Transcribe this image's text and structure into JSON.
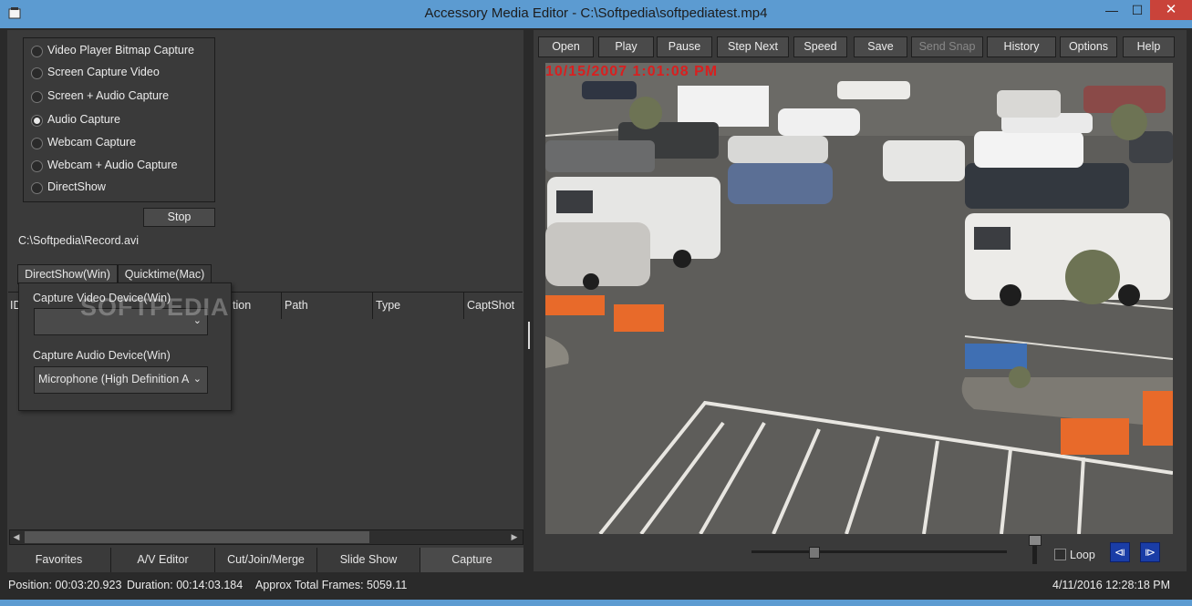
{
  "window": {
    "title": "Accessory Media Editor - C:\\Softpedia\\softpediatest.mp4",
    "min_glyph": "—",
    "max_glyph": "☐",
    "close_glyph": "✕"
  },
  "capture_modes": {
    "items": [
      {
        "label": "Video Player Bitmap Capture",
        "selected": false
      },
      {
        "label": "Screen Capture Video",
        "selected": false
      },
      {
        "label": "Screen + Audio Capture",
        "selected": false
      },
      {
        "label": "Audio Capture",
        "selected": true
      },
      {
        "label": "Webcam Capture",
        "selected": false
      },
      {
        "label": "Webcam + Audio Capture",
        "selected": false
      },
      {
        "label": "DirectShow",
        "selected": false
      }
    ]
  },
  "stop_label": "Stop",
  "output_path": "C:\\Softpedia\\Record.avi",
  "capture_tabs": {
    "directshow": "DirectShow(Win)",
    "quicktime": "Quicktime(Mac)"
  },
  "device_popup": {
    "video_label": "Capture Video Device(Win)",
    "video_value": "",
    "audio_label": "Capture Audio Device(Win)",
    "audio_value": "Microphone (High Definition A"
  },
  "grid": {
    "columns": [
      "ID",
      "tion",
      "Path",
      "Type",
      "CaptShot"
    ]
  },
  "watermark": "SOFTPEDIA",
  "bottom_tabs": [
    "Favorites",
    "A/V Editor",
    "Cut/Join/Merge",
    "Slide Show",
    "Capture"
  ],
  "toolbar": {
    "open": "Open",
    "play": "Play",
    "pause": "Pause",
    "step_next": "Step Next",
    "speed": "Speed",
    "save": "Save",
    "send_snap": "Send Snap",
    "history": "History",
    "options": "Options",
    "help": "Help"
  },
  "video": {
    "timestamp": "10/15/2007 1:01:08 PM"
  },
  "playback": {
    "loop_label": "Loop",
    "position_fraction": 0.25
  },
  "status": {
    "position": "Position: 00:03:20.923",
    "duration": "Duration: 00:14:03.184",
    "frames": "Approx Total Frames: 5059.11",
    "datetime": "4/11/2016 12:28:18 PM"
  },
  "colors": {
    "titlebar": "#5c9bd1",
    "close": "#c9433a",
    "timestamp": "#d91f1f",
    "nav_button": "#1a3da6"
  }
}
